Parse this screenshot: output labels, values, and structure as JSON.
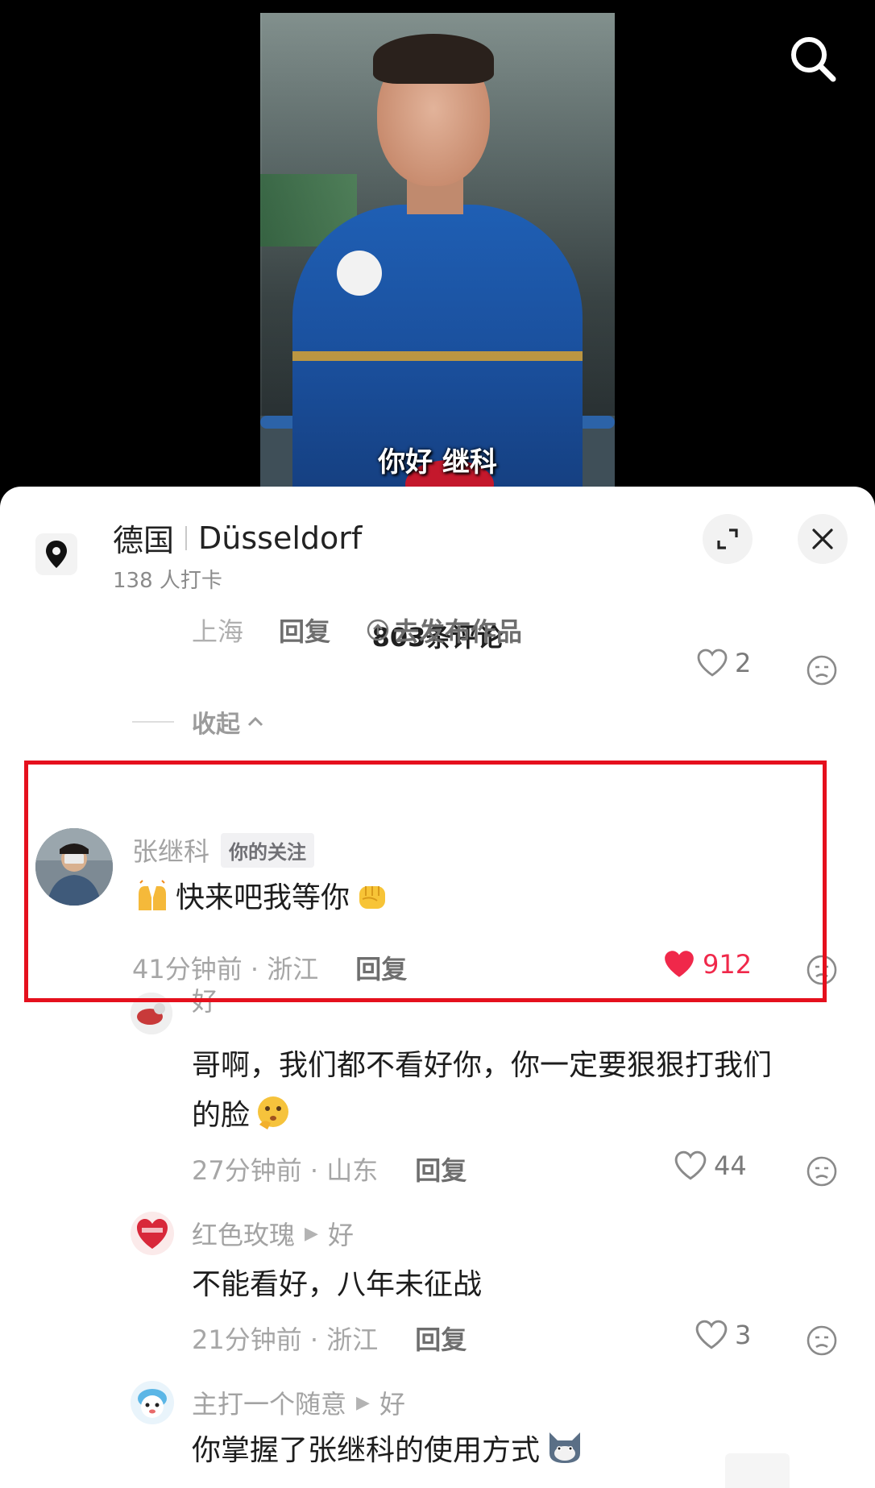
{
  "video": {
    "caption": "你好 继科",
    "search_icon": "search-icon"
  },
  "location": {
    "country": "德国",
    "city": "Düsseldorf",
    "checkins": "138 人打卡"
  },
  "comments_header": {
    "count_label": "803条评论"
  },
  "reply_prev": {
    "region": "上海",
    "reply_label": "回复",
    "publish_label": "去发布作品",
    "likes": "2"
  },
  "collapse_label": "收起",
  "comments": [
    {
      "name": "张继科",
      "tag": "你的关注",
      "text": "快来吧我等你",
      "time": "41分钟前 · 浙江",
      "reply_label": "回复",
      "likes": "912",
      "liked": true
    },
    {
      "name": "好",
      "text_line1": "哥啊，我们都不看好你，你一定要狠狠打我们",
      "text_line2": "的脸",
      "time": "27分钟前 · 山东",
      "reply_label": "回复",
      "likes": "44"
    },
    {
      "name": "红色玫瑰",
      "reply_to": "好",
      "text": "不能看好，八年未征战",
      "time": "21分钟前 · 浙江",
      "reply_label": "回复",
      "likes": "3"
    },
    {
      "name": "主打一个随意",
      "reply_to": "好",
      "text": "你掌握了张继科的使用方式"
    }
  ],
  "colors": {
    "highlight": "#e5101d",
    "like_red": "#f0284a",
    "muted": "#a3a3a3"
  }
}
